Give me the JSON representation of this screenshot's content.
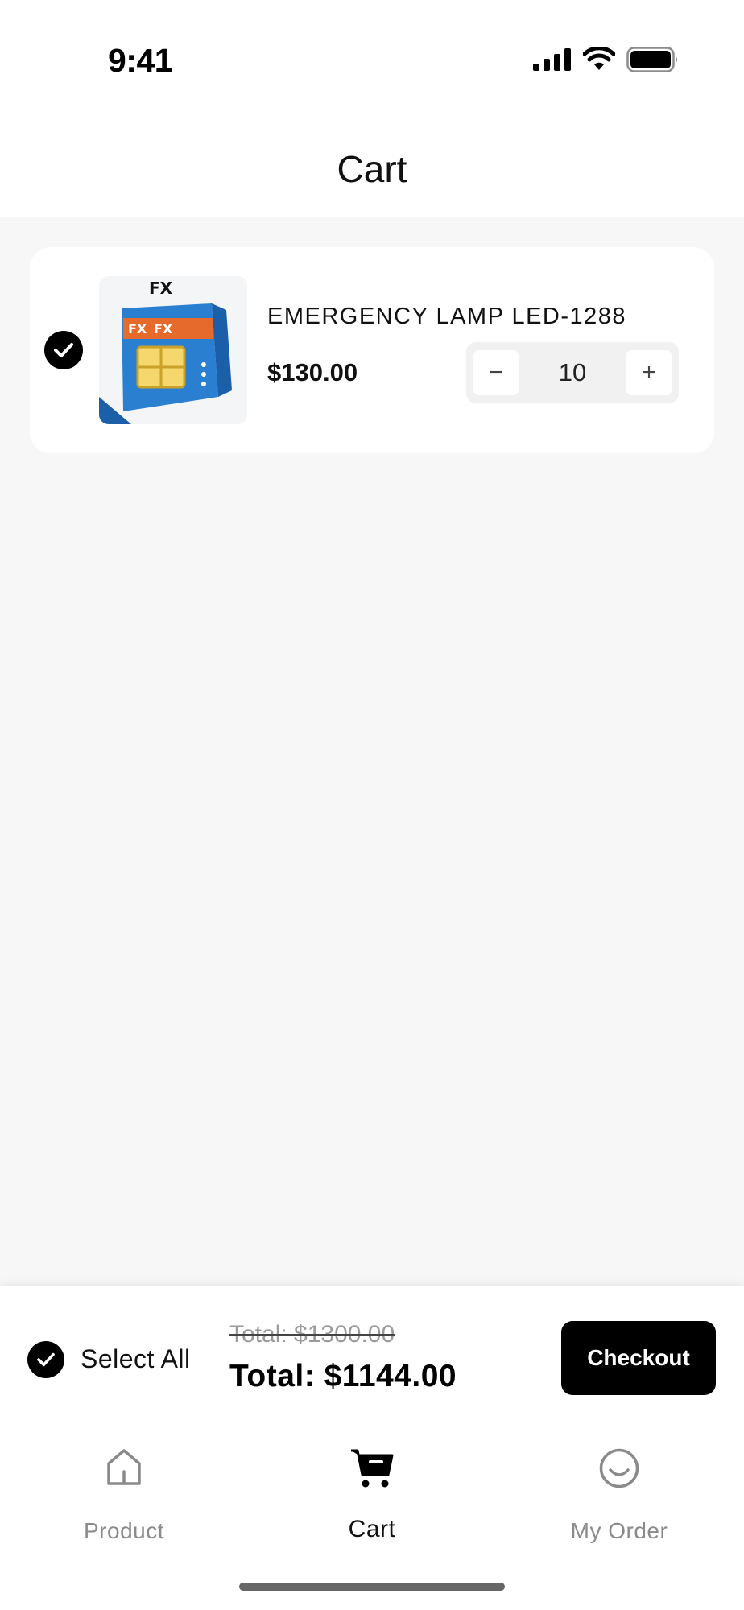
{
  "status_bar": {
    "time": "9:41"
  },
  "header": {
    "title": "Cart"
  },
  "cart_items": [
    {
      "name": "EMERGENCY LAMP LED-1288",
      "price": "$130.00",
      "quantity": "10",
      "selected": true,
      "image_brand": "FX"
    }
  ],
  "stepper": {
    "minus": "−",
    "plus": "+"
  },
  "checkout_bar": {
    "select_all_label": "Select All",
    "total_original": "Total: $1300.00",
    "total_final": "Total: $1144.00",
    "checkout_label": "Checkout"
  },
  "tab_bar": {
    "items": [
      {
        "label": "Product",
        "icon": "home-icon",
        "active": false
      },
      {
        "label": "Cart",
        "icon": "cart-icon",
        "active": true
      },
      {
        "label": "My Order",
        "icon": "smiley-icon",
        "active": false
      }
    ]
  },
  "colors": {
    "background": "#f7f7f7",
    "card": "#ffffff",
    "primary": "#000000",
    "muted": "#8a8a8a"
  }
}
